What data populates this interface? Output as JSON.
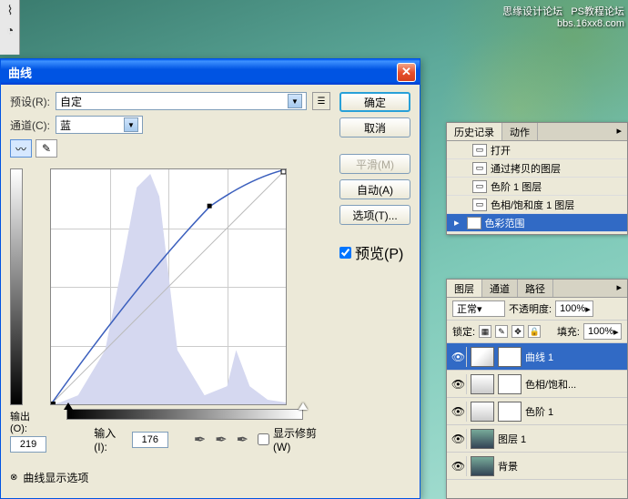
{
  "watermark": {
    "line1": "思缘设计论坛",
    "line2": "PS教程论坛",
    "line3": "bbs.16xx8.com"
  },
  "curves": {
    "title": "曲线",
    "preset_label": "预设(R):",
    "preset_value": "自定",
    "channel_label": "通道(C):",
    "channel_value": "蓝",
    "output_label": "输出(O):",
    "output_value": "219",
    "input_label": "输入(I):",
    "input_value": "176",
    "show_clipping": "显示修剪(W)",
    "options_toggle": "曲线显示选项",
    "buttons": {
      "ok": "确定",
      "cancel": "取消",
      "smooth": "平滑(M)",
      "auto": "自动(A)",
      "options": "选项(T)..."
    },
    "preview_label": "预览(P)",
    "preview_checked": true
  },
  "history": {
    "tabs": [
      "历史记录",
      "动作"
    ],
    "active_tab": 0,
    "items": [
      {
        "label": "打开",
        "selected": false
      },
      {
        "label": "通过拷贝的图层",
        "selected": false
      },
      {
        "label": "色阶 1 图层",
        "selected": false
      },
      {
        "label": "色相/饱和度 1 图层",
        "selected": false
      },
      {
        "label": "色彩范围",
        "selected": true
      }
    ]
  },
  "layers": {
    "tabs": [
      "图层",
      "通道",
      "路径"
    ],
    "active_tab": 0,
    "blend_mode": "正常",
    "opacity_label": "不透明度:",
    "opacity_value": "100%",
    "lock_label": "锁定:",
    "fill_label": "填充:",
    "fill_value": "100%",
    "items": [
      {
        "label": "曲线 1",
        "selected": true,
        "type": "curves"
      },
      {
        "label": "色相/饱和...",
        "selected": false,
        "type": "huesat"
      },
      {
        "label": "色阶 1",
        "selected": false,
        "type": "levels"
      },
      {
        "label": "图层 1",
        "selected": false,
        "type": "layer"
      },
      {
        "label": "背景",
        "selected": false,
        "type": "bg"
      }
    ]
  }
}
